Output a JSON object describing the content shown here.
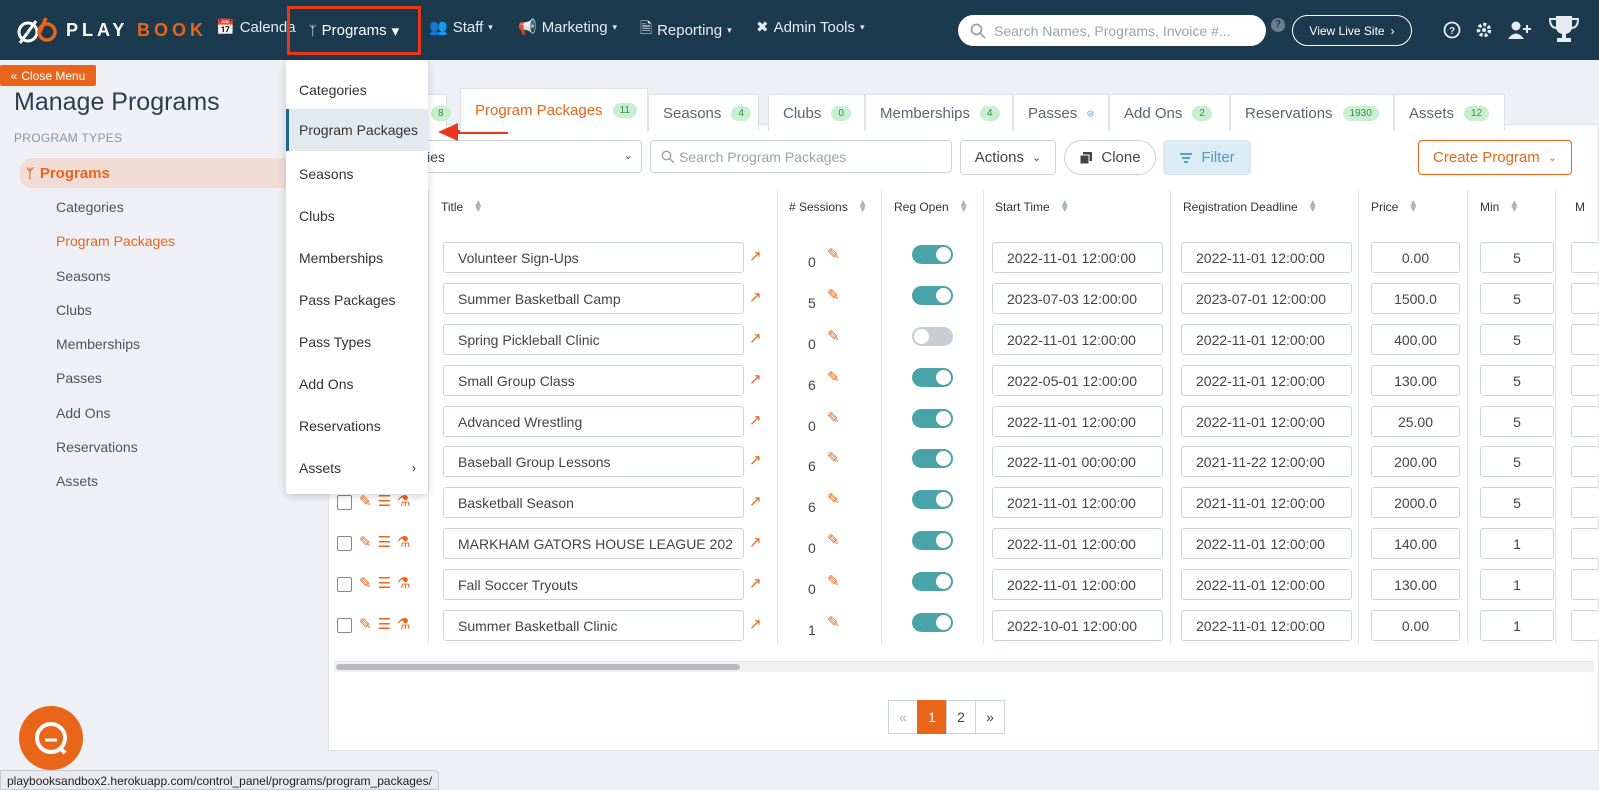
{
  "nav": {
    "logo_play": "PLAY",
    "logo_book": "BOOK",
    "items": [
      {
        "label": "Calendar",
        "icon": "calendar-icon"
      },
      {
        "label": "Programs",
        "icon": "branch-icon"
      },
      {
        "label": "Staff",
        "icon": "users-icon"
      },
      {
        "label": "Marketing",
        "icon": "megaphone-icon"
      },
      {
        "label": "Reporting",
        "icon": "document-icon"
      },
      {
        "label": "Admin Tools",
        "icon": "tools-icon"
      }
    ],
    "search_placeholder": "Search Names, Programs, Invoice #...",
    "help_badge": "?",
    "view_live_site": "View Live Site"
  },
  "close_menu": "Close Menu",
  "sidebar": {
    "title": "Manage Programs",
    "section_label": "PROGRAM TYPES",
    "active_item": "Programs",
    "items": [
      "Categories",
      "Program Packages",
      "Seasons",
      "Clubs",
      "Memberships",
      "Passes",
      "Add Ons",
      "Reservations",
      "Assets"
    ],
    "current": "Program Packages"
  },
  "dropdown": {
    "items": [
      "Categories",
      "Program Packages",
      "Seasons",
      "Clubs",
      "Memberships",
      "Pass Packages",
      "Pass Types",
      "Add Ons",
      "Reservations",
      "Assets"
    ],
    "active": "Program Packages"
  },
  "tabs": [
    {
      "label": "",
      "count": "8"
    },
    {
      "label": "Program Packages",
      "count": "11"
    },
    {
      "label": "Seasons",
      "count": "4"
    },
    {
      "label": "Clubs",
      "count": "0"
    },
    {
      "label": "Memberships",
      "count": "4"
    },
    {
      "label": "Passes",
      "count": ""
    },
    {
      "label": "Add Ons",
      "count": "2"
    },
    {
      "label": "Reservations",
      "count": "1930"
    },
    {
      "label": "Assets",
      "count": "12"
    }
  ],
  "toolbar": {
    "select_value": "ies",
    "search_placeholder": "Search Program Packages",
    "actions": "Actions",
    "clone": "Clone",
    "filter": "Filter",
    "create": "Create Program"
  },
  "table": {
    "headers": [
      "Title",
      "# Sessions",
      "Reg Open",
      "Start Time",
      "Registration Deadline",
      "Price",
      "Min",
      "M"
    ],
    "rows": [
      {
        "title": "Volunteer Sign-Ups",
        "sessions": "0",
        "reg_open": true,
        "start": "2022-11-01 12:00:00",
        "deadline": "2022-11-01 12:00:00",
        "price": "0.00",
        "min": "5"
      },
      {
        "title": "Summer Basketball Camp",
        "sessions": "5",
        "reg_open": true,
        "start": "2023-07-03 12:00:00",
        "deadline": "2023-07-01 12:00:00",
        "price": "1500.0",
        "min": "5"
      },
      {
        "title": "Spring Pickleball Clinic",
        "sessions": "0",
        "reg_open": false,
        "start": "2022-11-01 12:00:00",
        "deadline": "2022-11-01 12:00:00",
        "price": "400.00",
        "min": "5"
      },
      {
        "title": "Small Group Class",
        "sessions": "6",
        "reg_open": true,
        "start": "2022-05-01 12:00:00",
        "deadline": "2022-11-01 12:00:00",
        "price": "130.00",
        "min": "5"
      },
      {
        "title": "Advanced Wrestling",
        "sessions": "0",
        "reg_open": true,
        "start": "2022-11-01 12:00:00",
        "deadline": "2022-11-01 12:00:00",
        "price": "25.00",
        "min": "5"
      },
      {
        "title": "Baseball Group Lessons",
        "sessions": "6",
        "reg_open": true,
        "start": "2022-11-01 00:00:00",
        "deadline": "2021-11-22 12:00:00",
        "price": "200.00",
        "min": "5"
      },
      {
        "title": "Basketball Season",
        "sessions": "6",
        "reg_open": true,
        "start": "2021-11-01 12:00:00",
        "deadline": "2021-11-01 12:00:00",
        "price": "2000.0",
        "min": "5"
      },
      {
        "title": "MARKHAM GATORS HOUSE LEAGUE 202",
        "sessions": "0",
        "reg_open": true,
        "start": "2022-11-01 12:00:00",
        "deadline": "2022-11-01 12:00:00",
        "price": "140.00",
        "min": "1"
      },
      {
        "title": "Fall Soccer Tryouts",
        "sessions": "0",
        "reg_open": true,
        "start": "2022-11-01 12:00:00",
        "deadline": "2022-11-01 12:00:00",
        "price": "130.00",
        "min": "1"
      },
      {
        "title": "Summer Basketball Clinic",
        "sessions": "1",
        "reg_open": true,
        "start": "2022-10-01 12:00:00",
        "deadline": "2022-11-01 12:00:00",
        "price": "0.00",
        "min": "1"
      }
    ]
  },
  "pagination": {
    "prev": "«",
    "pages": [
      "1",
      "2"
    ],
    "current": "1",
    "next": "»"
  },
  "status_url": "playbooksandbox2.herokuapp.com/control_panel/programs/program_packages/",
  "colors": {
    "brand": "#e8651a",
    "nav_bg": "#1c3a4e",
    "highlight": "#e8371a",
    "toggle_on": "#4aa3a8"
  }
}
